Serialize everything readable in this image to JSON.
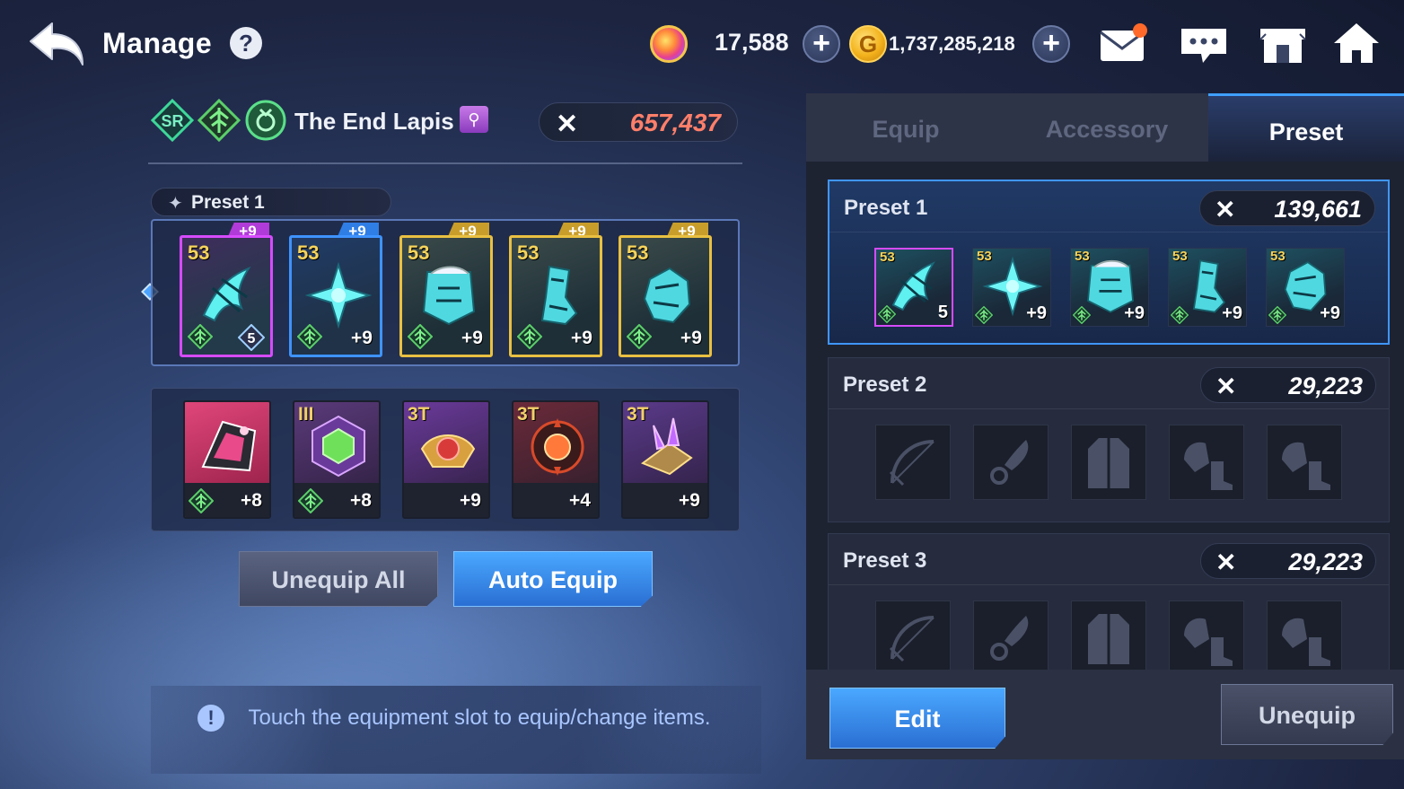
{
  "header": {
    "title": "Manage",
    "gems": "17,588",
    "gold": "1,737,285,218",
    "gold_symbol": "G"
  },
  "character": {
    "rarity": "SR",
    "name": "The End Lapis",
    "power": "657,437"
  },
  "equip_preset_label": "Preset 1",
  "equipment": [
    {
      "level": "53",
      "enhance_top": "+9",
      "enhance": "5",
      "frame": "purple"
    },
    {
      "level": "53",
      "enhance_top": "+9",
      "enhance": "+9",
      "frame": "blue"
    },
    {
      "level": "53",
      "enhance_top": "+9",
      "enhance": "+9",
      "frame": "gold"
    },
    {
      "level": "53",
      "enhance_top": "+9",
      "enhance": "+9",
      "frame": "gold"
    },
    {
      "level": "53",
      "enhance_top": "+9",
      "enhance": "+9",
      "frame": "gold"
    }
  ],
  "accessories": [
    {
      "tier": "",
      "enhance": "+8"
    },
    {
      "tier": "III",
      "enhance": "+8"
    },
    {
      "tier": "3T",
      "enhance": "+9"
    },
    {
      "tier": "3T",
      "enhance": "+4"
    },
    {
      "tier": "3T",
      "enhance": "+9"
    }
  ],
  "buttons": {
    "unequip_all": "Unequip All",
    "auto_equip": "Auto Equip",
    "edit": "Edit",
    "unequip": "Unequip"
  },
  "hint": "Touch the equipment slot to equip/change items.",
  "hint_icon": "!",
  "tabs": [
    "Equip",
    "Accessory",
    "Preset"
  ],
  "active_tab": "Preset",
  "presets": [
    {
      "name": "Preset 1",
      "power": "139,661",
      "items": [
        {
          "level": "53",
          "enhance": "5"
        },
        {
          "level": "53",
          "enhance": "+9"
        },
        {
          "level": "53",
          "enhance": "+9"
        },
        {
          "level": "53",
          "enhance": "+9"
        },
        {
          "level": "53",
          "enhance": "+9"
        }
      ]
    },
    {
      "name": "Preset 2",
      "power": "29,223"
    },
    {
      "name": "Preset 3",
      "power": "29,223"
    }
  ],
  "icons": {
    "back": "back-arrow-icon",
    "help": "help-icon",
    "mail": "mail-icon",
    "chat": "chat-icon",
    "shop": "shop-icon",
    "home": "home-icon",
    "combat_power": "crossed-swords-icon"
  },
  "colors": {
    "power_red": "#ff7f6a",
    "accent_blue": "#3f96ff",
    "notification": "#ff6a2a"
  }
}
